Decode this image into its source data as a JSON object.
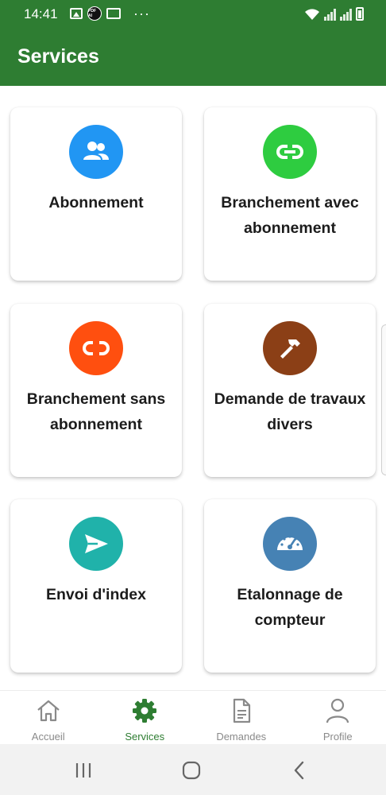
{
  "status_bar": {
    "time": "14:41",
    "left_icons": [
      "image-icon",
      "pdf-app-icon",
      "mail-icon",
      "more-dots-icon"
    ],
    "pdf_badge": "PDF AI",
    "more": "···",
    "right_icons": [
      "wifi-icon",
      "signal-icon",
      "signal-icon",
      "battery-icon"
    ]
  },
  "header": {
    "title": "Services",
    "background": "#2e7d32"
  },
  "services": [
    {
      "label": "Abonnement",
      "icon": "users-icon",
      "color": "#2196f3"
    },
    {
      "label": "Branchement avec abonnement",
      "icon": "link-icon",
      "color": "#2ecc40"
    },
    {
      "label": "Branchement sans abonnement",
      "icon": "unlink-icon",
      "color": "#ff4f0f"
    },
    {
      "label": "Demande de travaux divers",
      "icon": "hammer-icon",
      "color": "#8b3f16"
    },
    {
      "label": "Envoi d'index",
      "icon": "send-icon",
      "color": "#20b2aa"
    },
    {
      "label": "Etalonnage de compteur",
      "icon": "speedometer-icon",
      "color": "#4682b4"
    }
  ],
  "bottom_nav": {
    "items": [
      {
        "label": "Accueil",
        "icon": "home-icon",
        "active": false
      },
      {
        "label": "Services",
        "icon": "gear-icon",
        "active": true
      },
      {
        "label": "Demandes",
        "icon": "document-icon",
        "active": false
      },
      {
        "label": "Profile",
        "icon": "user-icon",
        "active": false
      }
    ],
    "active_color": "#2e7d32",
    "inactive_color": "#8a8a8a"
  },
  "system_nav": [
    "recents-button",
    "home-button",
    "back-button"
  ]
}
